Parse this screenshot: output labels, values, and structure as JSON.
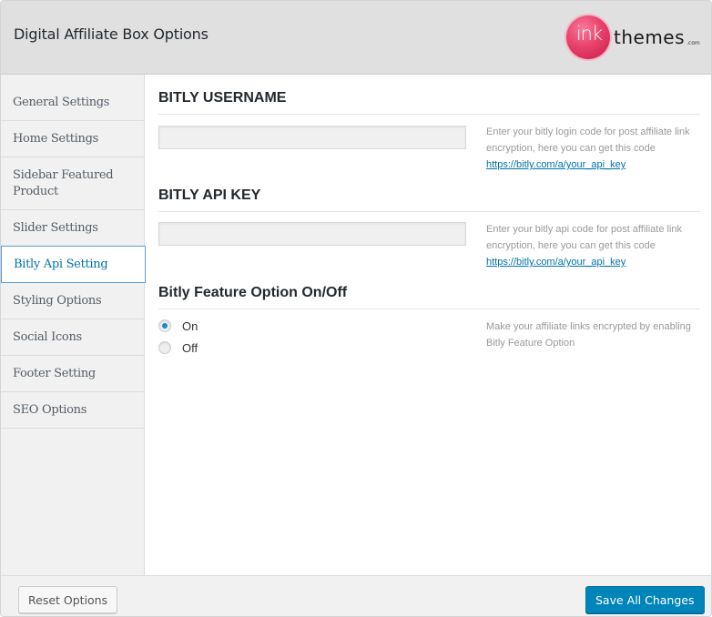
{
  "header": {
    "title": "Digital Affiliate Box Options",
    "logo": {
      "ink": "ink",
      "themes": "themes",
      "com": ".com"
    }
  },
  "sidebar": {
    "items": [
      {
        "label": "General Settings",
        "active": false
      },
      {
        "label": "Home Settings",
        "active": false
      },
      {
        "label": "Sidebar Featured Product",
        "active": false
      },
      {
        "label": "Slider Settings",
        "active": false
      },
      {
        "label": "Bitly Api Setting",
        "active": true
      },
      {
        "label": "Styling Options",
        "active": false
      },
      {
        "label": "Social Icons",
        "active": false
      },
      {
        "label": "Footer Setting",
        "active": false
      },
      {
        "label": "SEO Options",
        "active": false
      }
    ]
  },
  "main": {
    "username": {
      "title": "BITLY USERNAME",
      "value": "",
      "placeholder": "",
      "help": "Enter your bitly login code for post affiliate link encryption, here you can get this code",
      "link": "https://bitly.com/a/your_api_key"
    },
    "apikey": {
      "title": "BITLY API KEY",
      "value": "",
      "placeholder": "",
      "help": "Enter your bitly api code for post affiliate link encryption, here you can get this code",
      "link": "https://bitly.com/a/your_api_key"
    },
    "feature": {
      "title": "Bitly Feature Option On/Off",
      "options": [
        {
          "label": "On",
          "checked": true
        },
        {
          "label": "Off",
          "checked": false
        }
      ],
      "help": "Make your affiliate links encrypted by enabling Bitly Feature Option"
    }
  },
  "footer": {
    "reset_label": "Reset Options",
    "save_label": "Save All Changes"
  },
  "colors": {
    "accent": "#0085ba",
    "link": "#0073aa",
    "active_border": "#5b9dd9",
    "logo_pink": "#e8426b"
  }
}
